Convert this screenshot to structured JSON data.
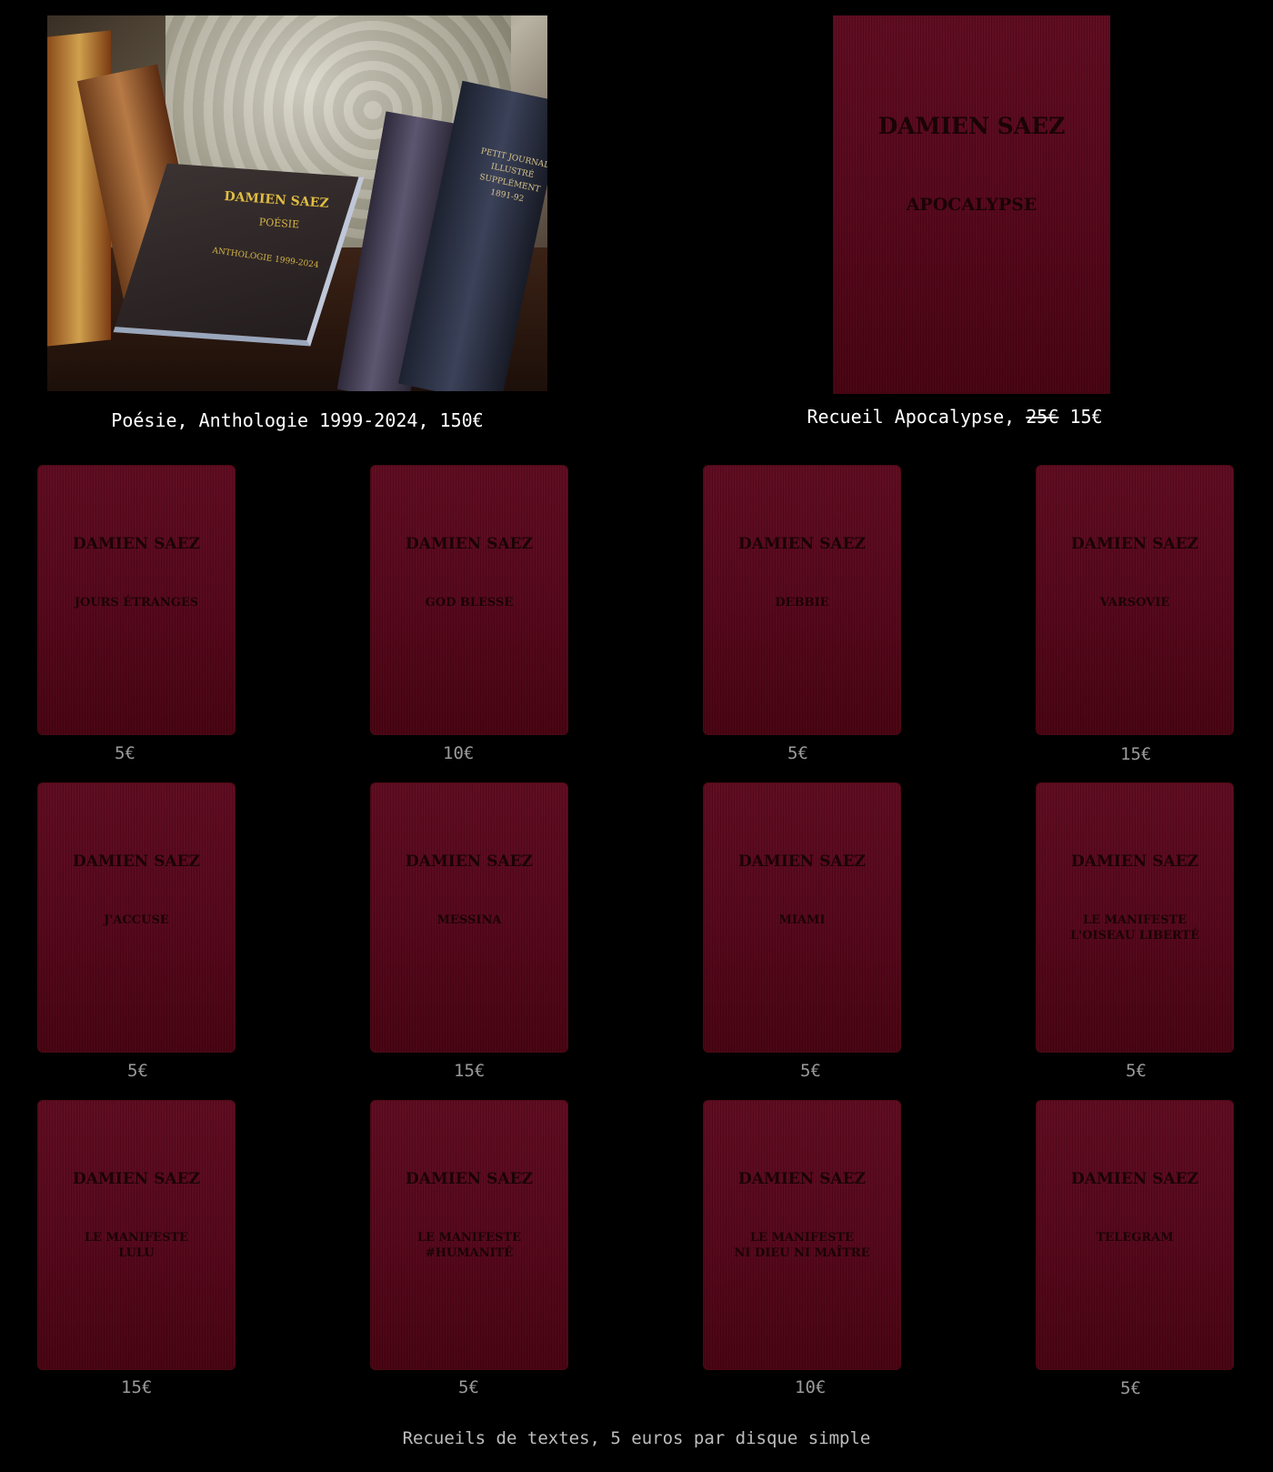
{
  "featured": [
    {
      "photo": {
        "cover_author": "DAMIEN SAEZ",
        "cover_title": "POÉSIE",
        "cover_subtitle": "ANTHOLOGIE 1999-2024",
        "spine_text": "PETIT JOURNAL ILLUSTRÉ SUPPLÉMENT 1891-92"
      },
      "caption": "Poésie, Anthologie 1999-2024, 150€"
    },
    {
      "cover_author": "DAMIEN SAEZ",
      "cover_title": "APOCALYPSE",
      "caption_prefix": "Recueil Apocalypse,",
      "old_price": "25€",
      "price": "15€"
    }
  ],
  "booklets": [
    {
      "author": "DAMIEN SAEZ",
      "title": "JOURS ÉTRANGES",
      "price": "5€"
    },
    {
      "author": "DAMIEN SAEZ",
      "title": "GOD BLESSE",
      "price": "10€"
    },
    {
      "author": "DAMIEN SAEZ",
      "title": "DEBBIE",
      "price": "5€"
    },
    {
      "author": "DAMIEN SAEZ",
      "title": "VARSOVIE",
      "price": "15€"
    },
    {
      "author": "DAMIEN SAEZ",
      "title": "J'ACCUSE",
      "price": "5€"
    },
    {
      "author": "DAMIEN SAEZ",
      "title": "MESSINA",
      "price": "15€"
    },
    {
      "author": "DAMIEN SAEZ",
      "title": "MIAMI",
      "price": "5€"
    },
    {
      "author": "DAMIEN SAEZ",
      "title": "LE MANIFESTE\nL'OISEAU LIBERTÉ",
      "price": "5€"
    },
    {
      "author": "DAMIEN SAEZ",
      "title": "LE MANIFESTE\nLULU",
      "price": "15€"
    },
    {
      "author": "DAMIEN SAEZ",
      "title": "LE MANIFESTE\n#HUMANITÉ",
      "price": "5€"
    },
    {
      "author": "DAMIEN SAEZ",
      "title": "LE MANIFESTE\nNI DIEU NI MAÎTRE",
      "price": "10€"
    },
    {
      "author": "DAMIEN SAEZ",
      "title": "TELEGRAM",
      "price": "5€"
    }
  ],
  "footer": "Recueils de textes, 5 euros par disque simple",
  "colors": {
    "background": "#000000",
    "cover_red": "#5e0a1f",
    "price_gray": "#9a9a9a"
  }
}
